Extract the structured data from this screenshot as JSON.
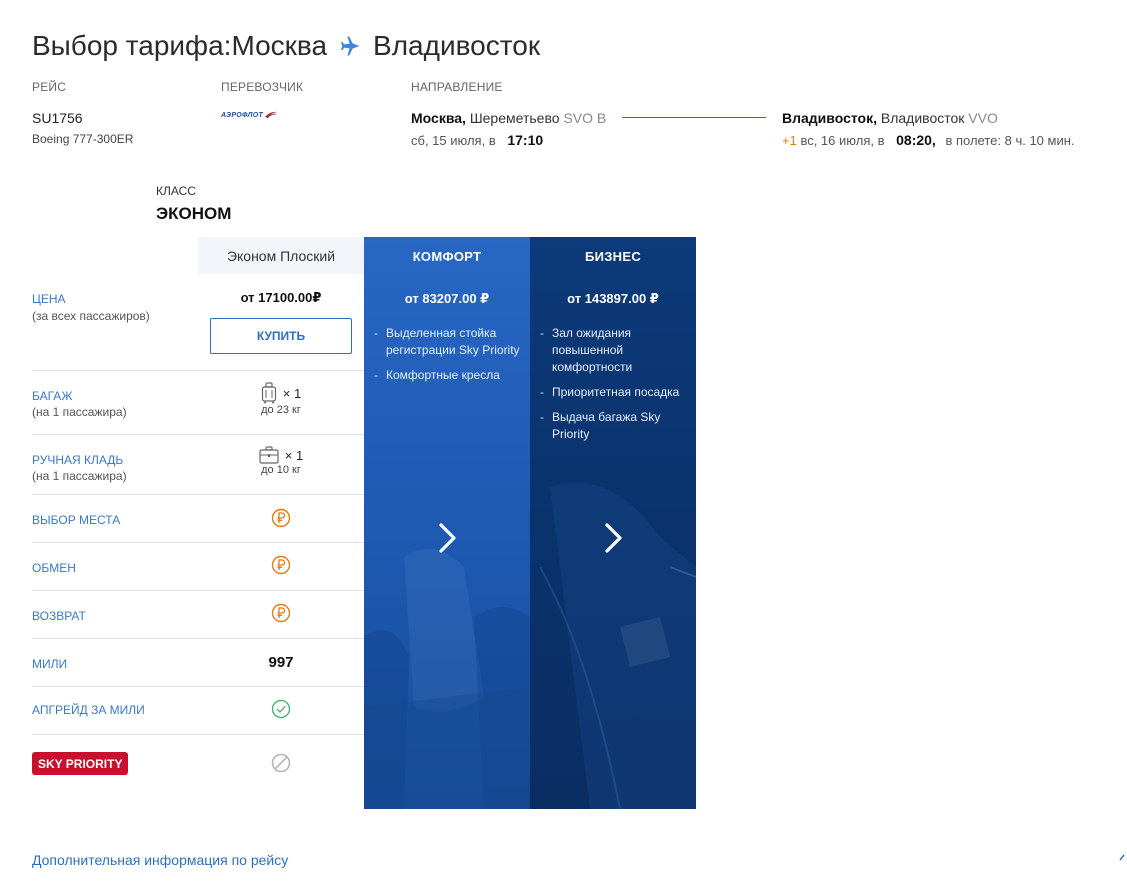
{
  "header": {
    "title_prefix": "Выбор тарифа: ",
    "origin_city": "Москва",
    "destination_city": "Владивосток"
  },
  "flight": {
    "flight_label": "РЕЙС",
    "carrier_label": "ПЕРЕВОЗЧИК",
    "direction_label": "НАПРАВЛЕНИЕ",
    "number": "SU1756",
    "aircraft": "Boeing 777-300ER",
    "carrier_logo_text": "АЭРОФЛОТ",
    "departure": {
      "city": "Москва,",
      "airport": "Шереметьево",
      "code": "SVO B",
      "date": "сб, 15 июля, в",
      "time": "17:10"
    },
    "arrival": {
      "city": "Владивосток,",
      "airport": "Владивосток",
      "code": "VVO",
      "day_offset": "+1",
      "date": "вс, 16 июля, в",
      "time": "08:20,",
      "duration": "в полете: 8 ч. 10 мин."
    }
  },
  "fare_class": {
    "label": "КЛАСС",
    "name": "ЭКОНОМ",
    "tariff_name": "Эконом Плоский"
  },
  "rows": {
    "price_label": "ЦЕНА",
    "price_sub": "(за всех пассажиров)",
    "price_value": "от 17100.00₽",
    "buy_button": "КУПИТЬ",
    "baggage_label": "БАГАЖ",
    "baggage_sub": "(на 1 пассажира)",
    "baggage_amount": "× 1",
    "baggage_limit": "до 23 кг",
    "carryon_label": "РУЧНАЯ КЛАДЬ",
    "carryon_sub": "(на 1 пассажира)",
    "carryon_amount": "× 1",
    "carryon_limit": "до 10 кг",
    "seat_label": "ВЫБОР МЕСТА",
    "exchange_label": "ОБМЕН",
    "refund_label": "ВОЗВРАТ",
    "miles_label": "МИЛИ",
    "miles_value": "997",
    "upgrade_label": "АПГРЕЙД ЗА МИЛИ",
    "sky_priority_badge": "SKY PRIORITY"
  },
  "panels": {
    "comfort": {
      "title": "КОМФОРТ",
      "price": "от 83207.00 ₽",
      "features": [
        "Выделенная стойка регистрации Sky Priority",
        "Комфортные кресла"
      ]
    },
    "business": {
      "title": "БИЗНЕС",
      "price": "от 143897.00 ₽",
      "features": [
        "Зал ожидания повышенной комфортности",
        "Приоритетная посадка",
        "Выдача багажа Sky Priority"
      ]
    }
  },
  "footer": {
    "more_info_link": "Дополнительная информация по рейсу"
  },
  "colors": {
    "accent_blue": "#2f6fc1",
    "comfort_panel": "#2867c4",
    "business_panel": "#0a336c",
    "paid_icon": "#e47a10",
    "included_icon": "#3ab26a",
    "unavailable_icon": "#b5b5b5",
    "sky_priority": "#c8102e"
  }
}
